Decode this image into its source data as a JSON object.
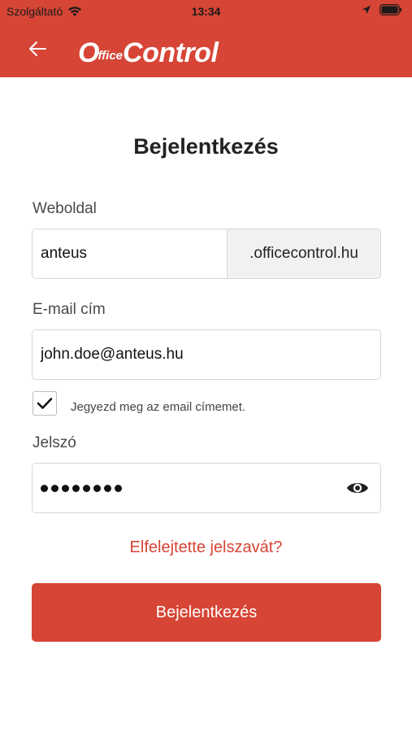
{
  "status_bar": {
    "carrier": "Szolgáltató",
    "time": "13:34"
  },
  "header": {
    "logo_letter": "O",
    "logo_small": "ffice",
    "logo_big": "Control",
    "accent_color": "#d64535"
  },
  "page": {
    "title": "Bejelentkezés"
  },
  "form": {
    "website_label": "Weboldal",
    "website_value": "anteus",
    "website_suffix": ".officecontrol.hu",
    "email_label": "E-mail cím",
    "email_value": "john.doe@anteus.hu",
    "remember_label": "Jegyezd meg az email címemet.",
    "remember_checked": true,
    "password_label": "Jelszó",
    "password_mask_length": 8,
    "forgot_link": "Elfelejtette jelszavát?",
    "submit_label": "Bejelentkezés"
  },
  "icons": {
    "back": "arrow-left-icon",
    "wifi": "wifi-icon",
    "location": "location-arrow-icon",
    "battery": "battery-icon",
    "checkbox": "checkmark-icon",
    "show_password": "eye-icon"
  }
}
